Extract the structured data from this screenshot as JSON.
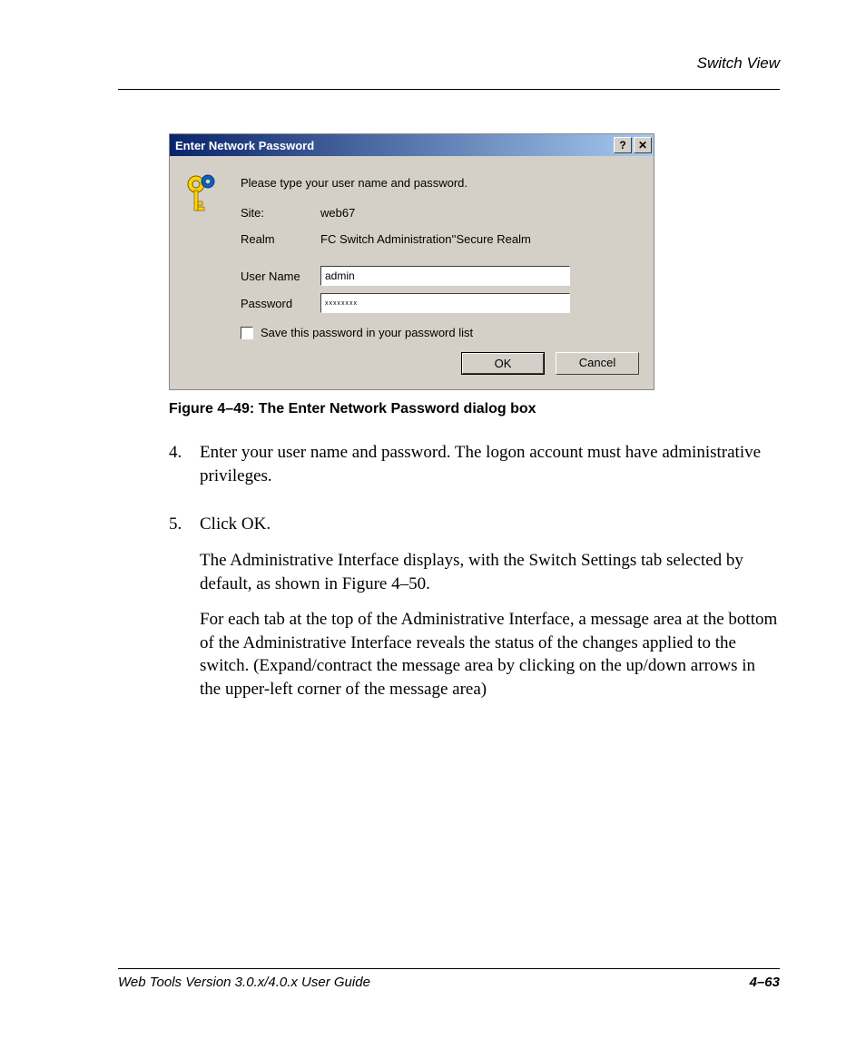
{
  "header": {
    "section": "Switch View"
  },
  "dialog": {
    "title": "Enter Network Password",
    "help_glyph": "?",
    "close_glyph": "✕",
    "prompt": "Please type your user name and password.",
    "site_label": "Site:",
    "site_value": "web67",
    "realm_label": "Realm",
    "realm_value": "FC Switch Administration''Secure Realm",
    "username_label": "User Name",
    "username_value": "admin",
    "password_label": "Password",
    "password_value": "xxxxxxxx",
    "save_pw_label": "Save this password in your password list",
    "ok_label": "OK",
    "cancel_label": "Cancel"
  },
  "caption": "Figure 4–49:  The Enter Network Password dialog box",
  "steps": {
    "item4_num": "4.",
    "item4_text": "Enter your user name and password. The logon account must have administrative privileges.",
    "item5_num": "5.",
    "item5_text": "Click OK.",
    "item5_p1": "The Administrative Interface displays, with the Switch Settings tab selected by default, as shown in Figure 4–50.",
    "item5_p2": "For each tab at the top of the Administrative Interface, a message area at the bottom of the Administrative Interface reveals the status of the changes applied to the switch. (Expand/contract the message area by clicking on the up/down arrows in the upper-left corner of the message area)"
  },
  "footer": {
    "guide": "Web Tools Version 3.0.x/4.0.x User Guide",
    "page": "4–63"
  }
}
